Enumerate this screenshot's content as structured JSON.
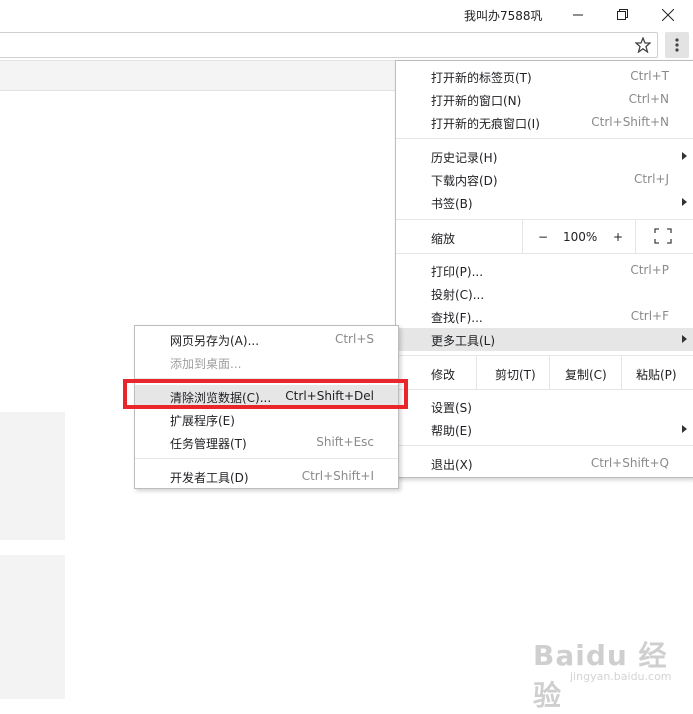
{
  "titlebar": {
    "profile_name": "我叫办7588巩",
    "minimize_icon": "minimize-icon",
    "restore_icon": "restore-icon",
    "close_icon": "close-icon"
  },
  "toolbar": {
    "bookmark_star_icon": "star-icon",
    "menu_icon": "kebab-menu-icon"
  },
  "main_menu": {
    "new_tab": {
      "label": "打开新的标签页(T)",
      "shortcut": "Ctrl+T"
    },
    "new_window": {
      "label": "打开新的窗口(N)",
      "shortcut": "Ctrl+N"
    },
    "new_incognito": {
      "label": "打开新的无痕窗口(I)",
      "shortcut": "Ctrl+Shift+N"
    },
    "history": {
      "label": "历史记录(H)"
    },
    "downloads": {
      "label": "下载内容(D)",
      "shortcut": "Ctrl+J"
    },
    "bookmarks": {
      "label": "书签(B)"
    },
    "zoom": {
      "label": "缩放",
      "minus": "−",
      "value": "100%",
      "plus": "+"
    },
    "print": {
      "label": "打印(P)...",
      "shortcut": "Ctrl+P"
    },
    "cast": {
      "label": "投射(C)..."
    },
    "find": {
      "label": "查找(F)...",
      "shortcut": "Ctrl+F"
    },
    "more_tools": {
      "label": "更多工具(L)"
    },
    "edit": {
      "label": "修改",
      "cut": "剪切(T)",
      "copy": "复制(C)",
      "paste": "粘贴(P)"
    },
    "settings": {
      "label": "设置(S)"
    },
    "help": {
      "label": "帮助(E)"
    },
    "exit": {
      "label": "退出(X)",
      "shortcut": "Ctrl+Shift+Q"
    }
  },
  "sub_menu": {
    "save_page": {
      "label": "网页另存为(A)...",
      "shortcut": "Ctrl+S"
    },
    "add_to_desktop": {
      "label": "添加到桌面..."
    },
    "clear_data": {
      "label": "清除浏览数据(C)...",
      "shortcut": "Ctrl+Shift+Del"
    },
    "extensions": {
      "label": "扩展程序(E)"
    },
    "task_manager": {
      "label": "任务管理器(T)",
      "shortcut": "Shift+Esc"
    },
    "dev_tools": {
      "label": "开发者工具(D)",
      "shortcut": "Ctrl+Shift+I"
    }
  },
  "watermark": {
    "brand": "Baidu 经验",
    "url": "jingyan.baidu.com"
  },
  "colors": {
    "highlight_box": "#e8262c",
    "menu_hover": "#e6e6e6"
  }
}
